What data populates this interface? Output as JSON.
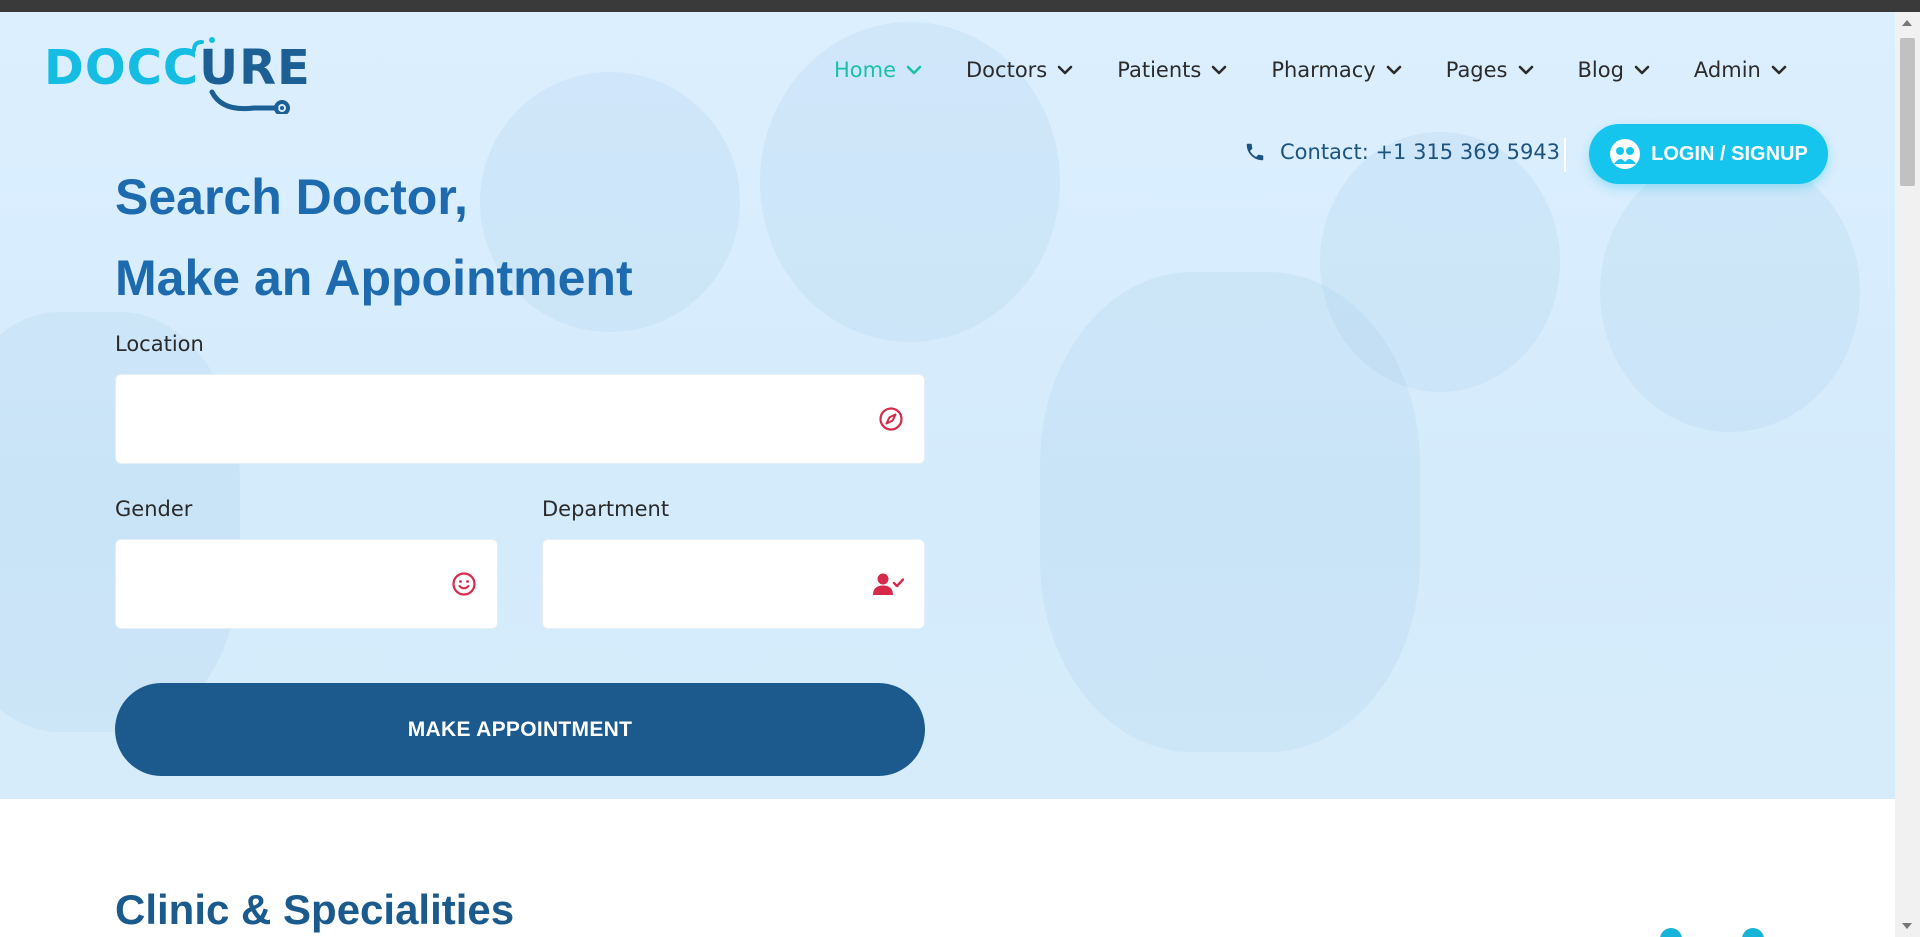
{
  "logo": {
    "part1": "DOCC",
    "part2": "URE",
    "brand_cyan": "#15bde3",
    "brand_navy": "#1b5f94"
  },
  "nav": {
    "items": [
      {
        "label": "Home",
        "active": true
      },
      {
        "label": "Doctors",
        "active": false
      },
      {
        "label": "Patients",
        "active": false
      },
      {
        "label": "Pharmacy",
        "active": false
      },
      {
        "label": "Pages",
        "active": false
      },
      {
        "label": "Blog",
        "active": false
      },
      {
        "label": "Admin",
        "active": false
      }
    ],
    "active_color": "#18c1a7"
  },
  "contact": {
    "text": "Contact: +1 315 369 5943",
    "icon": "phone-icon"
  },
  "login": {
    "label": "LOGIN / SIGNUP",
    "icon": "user-circle-icon",
    "color": "#16c5ee"
  },
  "hero": {
    "headline_line1": "Search Doctor,",
    "headline_line2": "Make an Appointment",
    "headline_color": "#1d6aaf"
  },
  "form": {
    "location": {
      "label": "Location",
      "value": "",
      "placeholder": "",
      "icon": "compass-icon"
    },
    "gender": {
      "label": "Gender",
      "value": "",
      "placeholder": "",
      "icon": "smile-icon"
    },
    "department": {
      "label": "Department",
      "value": "",
      "placeholder": "",
      "icon": "user-check-icon"
    },
    "icon_color": "#d62a4a",
    "submit_label": "MAKE APPOINTMENT",
    "submit_color": "#1c5a8e"
  },
  "section": {
    "title": "Clinic & Specialities"
  }
}
